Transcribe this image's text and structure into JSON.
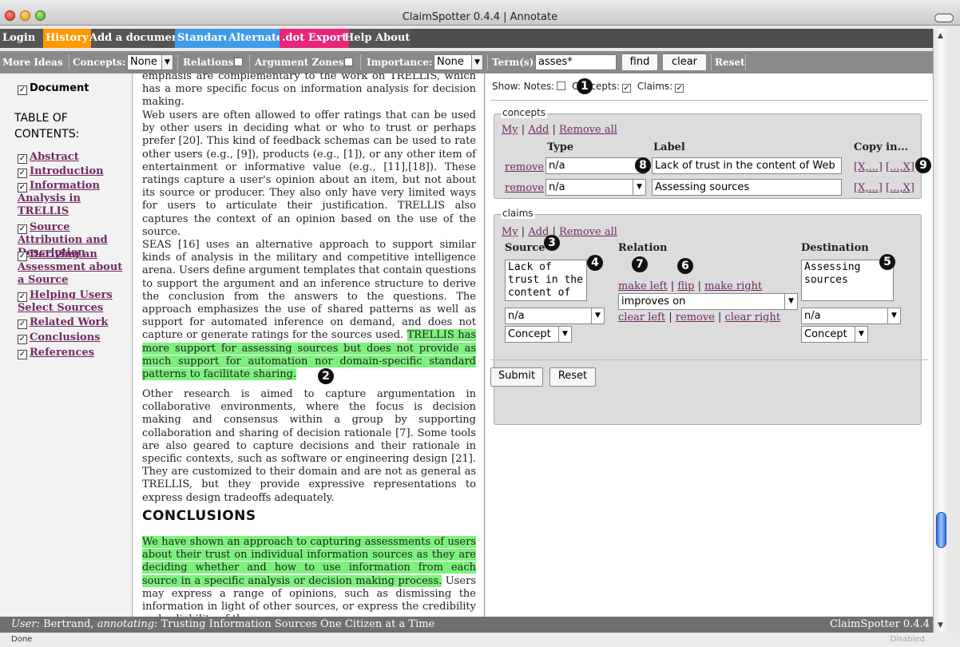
{
  "window": {
    "title": "ClaimSpotter 0.4.4 | Annotate"
  },
  "menu": [
    {
      "label": "Login",
      "bg": "#555555"
    },
    {
      "label": "History",
      "bg": "#ff9900"
    },
    {
      "label": "Add a document",
      "bg": "#555555"
    },
    {
      "label": "Standard",
      "bg": "#3f9be8"
    },
    {
      "label": "Alternate",
      "bg": "#3f9be8"
    },
    {
      "label": ".dot Export",
      "bg": "#e8257a"
    },
    {
      "label": "Help",
      "bg": "#555555"
    },
    {
      "label": "About",
      "bg": "#555555"
    }
  ],
  "toolbar": {
    "more_ideas": "More Ideas",
    "concepts_label": "Concepts:",
    "concepts_value": "None",
    "relations_label": "Relations:",
    "argument_zones_label": "Argument Zones:",
    "importance_label": "Importance:",
    "importance_value": "None",
    "terms_label": "Term(s):",
    "terms_value": "asses*",
    "find": "find",
    "clear": "clear",
    "reset": "Reset"
  },
  "sidebar": {
    "document_label": "Document",
    "toc_title": "TABLE OF CONTENTS:",
    "items": [
      "Abstract",
      "Introduction",
      "Information Analysis in TRELLIS",
      "Source Attribution and Description",
      "Deriving an Assessment about a Source",
      "Helping Users Select Sources",
      "Related Work",
      "Conclusions",
      "References"
    ]
  },
  "doc": {
    "p0": "emphasis are complementary to the work on TRELLIS, which has a more specific focus on information analysis for decision making.",
    "p1": "Web users are often allowed to offer ratings that can be used by other users in deciding what or who to trust or perhaps prefer [20]. This kind of feedback schemas can be used to rate other users (e.g., [9]), products (e.g., [1]), or any other item of entertainment or informative value (e.g., [11],[18]). These ratings capture a user's opinion about an item, but not about its source or producer. They also only have very limited ways for users to articulate their justification. TRELLIS also captures the context of an opinion based on the use of the source.",
    "p2": "SEAS [16] uses an alternative approach to support similar kinds of analysis in the military and competitive intelligence arena. Users define argument templates that contain questions to support the argument and an inference structure to derive the conclusion from the answers to the questions. The approach emphasizes the use of shared patterns as well as support for automated inference on demand, and does not capture or generate ratings for the sources used.",
    "p2_hl": "TRELLIS has more support for assessing sources but does not provide as much support for automation nor domain-specific standard patterns to facilitate sharing.",
    "p3": "Other research is aimed to capture argumentation in collaborative environments, where the focus is decision making and consensus within a group by supporting collaboration and sharing of decision rationale [7]. Some tools are also geared to capture decisions and their rationale in specific contexts, such as software or engineering design [21]. They are customized to their domain and are not as general as TRELLIS, but they provide expressive representations to express design tradeoffs adequately.",
    "heading": "CONCLUSIONS",
    "p4_hl": "We have shown an approach to capturing assessments of users about their trust on individual information sources as they are deciding whether and how to use information from each source in a specific analysis or decision making process.",
    "p4": "Users may express a range of opinions, such as dismissing the information in light of other sources, or express the credibility and reliability of the source"
  },
  "panel": {
    "show_label": "Show: Notes:",
    "concepts_label": "Concepts:",
    "claims_label": "Claims:",
    "concepts_legend": "concepts",
    "my": "My",
    "add": "Add",
    "remove_all": "Remove all",
    "col_type": "Type",
    "col_label": "Label",
    "col_copy": "Copy in...",
    "remove": "remove",
    "rows": [
      {
        "type": "n/a",
        "label": "Lack of trust in the content of Web",
        "copy1": "[X,...]",
        "copy2": "[...,X]"
      },
      {
        "type": "n/a",
        "label": "Assessing sources",
        "copy1": "[X,...]",
        "copy2": "[...,X]"
      }
    ],
    "claims_legend": "claims",
    "col_source": "Source",
    "col_relation": "Relation",
    "col_destination": "Destination",
    "source_text": "Lack of trust in the content of",
    "dest_text": "Assessing sources",
    "make_left": "make left",
    "flip": "flip",
    "make_right": "make right",
    "relation_value": "improves on",
    "clear_left": "clear left",
    "clear_right": "clear right",
    "src_type": "n/a",
    "src_kind": "Concept",
    "dst_type": "n/a",
    "dst_kind": "Concept",
    "submit": "Submit",
    "reset": "Reset"
  },
  "markers": [
    "1",
    "2",
    "3",
    "4",
    "5",
    "6",
    "7",
    "8",
    "9"
  ],
  "status": {
    "user_prefix": "User:",
    "user": "Bertrand,",
    "annotating": "annotating:",
    "doc_title": "Trusting Information Sources One Citizen at a Time",
    "version": "ClaimSpotter 0.4.4"
  },
  "bottom": {
    "left": "Done",
    "right": "Disabled"
  }
}
